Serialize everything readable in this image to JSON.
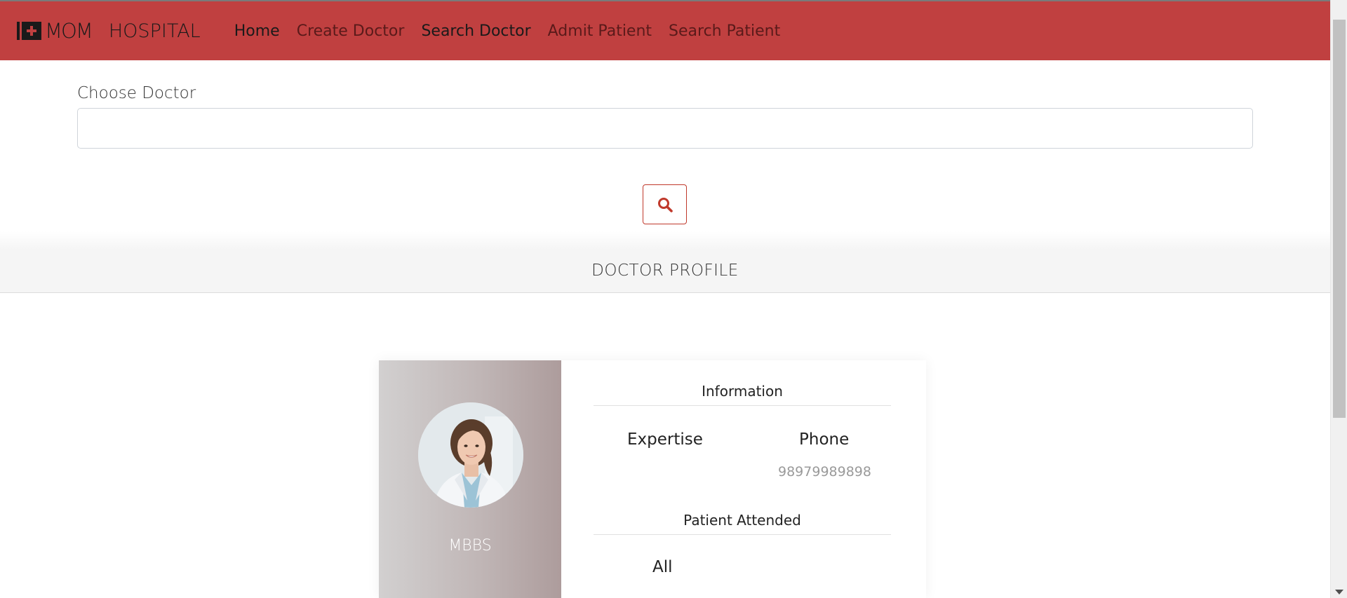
{
  "navbar": {
    "brand_mom": "MOM",
    "brand_hospital": "HOSPITAL",
    "links": [
      {
        "label": "Home"
      },
      {
        "label": "Create Doctor"
      },
      {
        "label": "Search Doctor"
      },
      {
        "label": "Admit Patient"
      },
      {
        "label": "Search Patient"
      }
    ],
    "color": "#c04040"
  },
  "search": {
    "label": "Choose Doctor",
    "value": "",
    "placeholder": ""
  },
  "section": {
    "title": "DOCTOR PROFILE"
  },
  "profile": {
    "degree": "MBBS",
    "information_title": "Information",
    "expertise_label": "Expertise",
    "expertise_value": "",
    "phone_label": "Phone",
    "phone_value": "98979989898",
    "patient_attended_title": "Patient Attended",
    "patient_attended_value": "All"
  },
  "icons": {
    "search": "search-icon",
    "logo": "medical-cross-icon"
  }
}
